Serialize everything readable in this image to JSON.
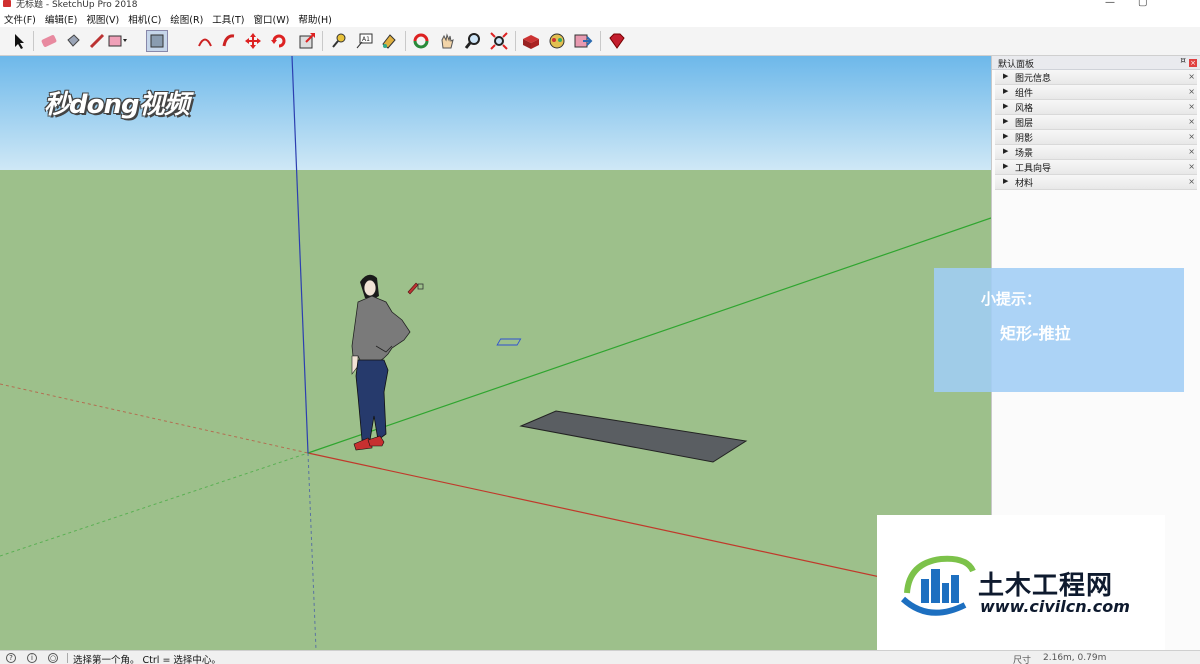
{
  "window": {
    "title": "无标题 - SketchUp Pro 2018",
    "minimize_icon": "minimize-icon",
    "maximize_icon": "maximize-icon"
  },
  "menu": [
    "文件(F)",
    "编辑(E)",
    "视图(V)",
    "相机(C)",
    "绘图(R)",
    "工具(T)",
    "窗口(W)",
    "帮助(H)"
  ],
  "toolbar_icons": [
    "select-icon",
    "eraser-icon",
    "paint-bucket-icon",
    "line-icon",
    "rectangle-icon",
    "arc-icon",
    "push-pull-icon",
    "move-icon",
    "rotate-icon",
    "scale-icon",
    "offset-icon",
    "tape-measure-icon",
    "text-icon",
    "paint-icon",
    "orbit-icon",
    "pan-icon",
    "zoom-icon",
    "zoom-extents-icon",
    "3d-warehouse-icon",
    "extension-warehouse-icon",
    "send-to-layout-icon",
    "ruby-icon"
  ],
  "watermark": "秒dong视频",
  "panel": {
    "title": "默认面板",
    "pin_icon": "pin-icon",
    "trays": [
      "图元信息",
      "组件",
      "风格",
      "图层",
      "阴影",
      "场景",
      "工具向导",
      "材料"
    ]
  },
  "tip": {
    "title": "小提示：",
    "text": "矩形-推拉"
  },
  "logo": {
    "name": "土木工程网",
    "url": "www.civilcn.com"
  },
  "status": {
    "message": "选择第一个角。 Ctrl = 选择中心。",
    "measure_label": "尺寸",
    "measure_value": "2.16m, 0.79m"
  },
  "colors": {
    "sky": "#7cc3ec",
    "ground": "#9dc08b",
    "axis_red": "#c0392b",
    "axis_green": "#2fa52f",
    "axis_blue": "#2c3fb0",
    "rectangle_fill": "#5a5e62"
  }
}
